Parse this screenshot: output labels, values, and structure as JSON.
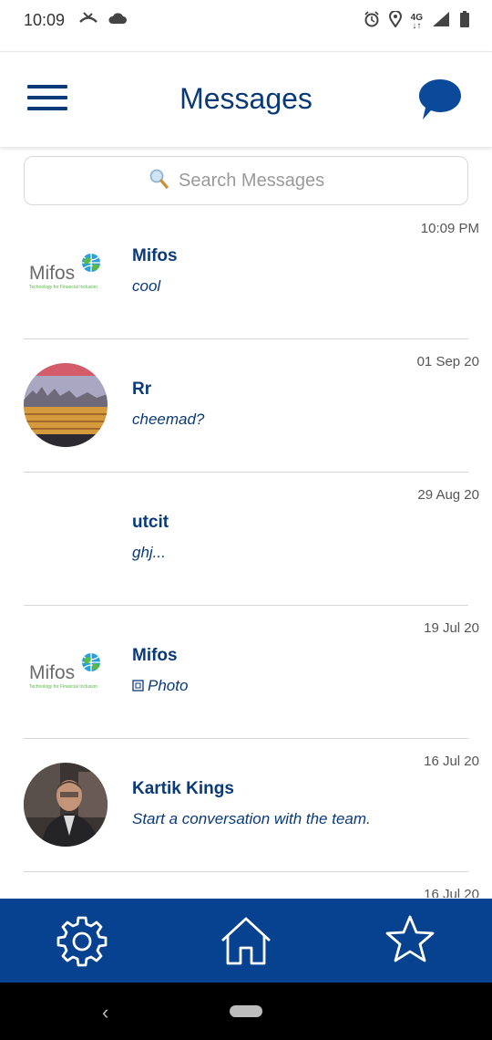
{
  "status_bar": {
    "time": "10:09",
    "left_icons": [
      "missed-call-icon",
      "cloud-icon"
    ],
    "right_icons": [
      "alarm-icon",
      "location-icon",
      "network-4g-icon",
      "signal-icon",
      "battery-icon"
    ],
    "network_label": "4G"
  },
  "header": {
    "title": "Messages",
    "menu_icon": "hamburger-menu-icon",
    "action_icon": "chat-bubble-icon"
  },
  "search": {
    "placeholder": "Search Messages",
    "icon": "search-icon"
  },
  "conversations": [
    {
      "name": "Mifos",
      "preview": "cool",
      "time": "10:09 PM",
      "avatar": "mifos-logo"
    },
    {
      "name": "Rr",
      "preview": "cheemad?",
      "time": "01 Sep 20",
      "avatar": "photo-landscape"
    },
    {
      "name": "utcit",
      "preview": "ghj...",
      "time": "29 Aug 20",
      "avatar": "none"
    },
    {
      "name": "Mifos",
      "preview": "Photo",
      "preview_icon": "image-icon",
      "time": "19 Jul 20",
      "avatar": "mifos-logo"
    },
    {
      "name": "Kartik Kings",
      "preview": "Start a conversation with the team.",
      "time": "16 Jul 20",
      "avatar": "photo-person"
    },
    {
      "name": "",
      "preview": "",
      "time": "16 Jul 20",
      "avatar": "none"
    }
  ],
  "logo": {
    "text": "Mifos",
    "tagline": "Technology for Financial Inclusion"
  },
  "bottom_nav": [
    {
      "icon": "settings-icon",
      "label": "Settings"
    },
    {
      "icon": "home-icon",
      "label": "Home"
    },
    {
      "icon": "star-icon",
      "label": "Favorites"
    }
  ],
  "colors": {
    "primary": "#0b3a78",
    "nav_background": "#06428f",
    "divider": "#d6d6d6",
    "muted_text": "#555555"
  }
}
